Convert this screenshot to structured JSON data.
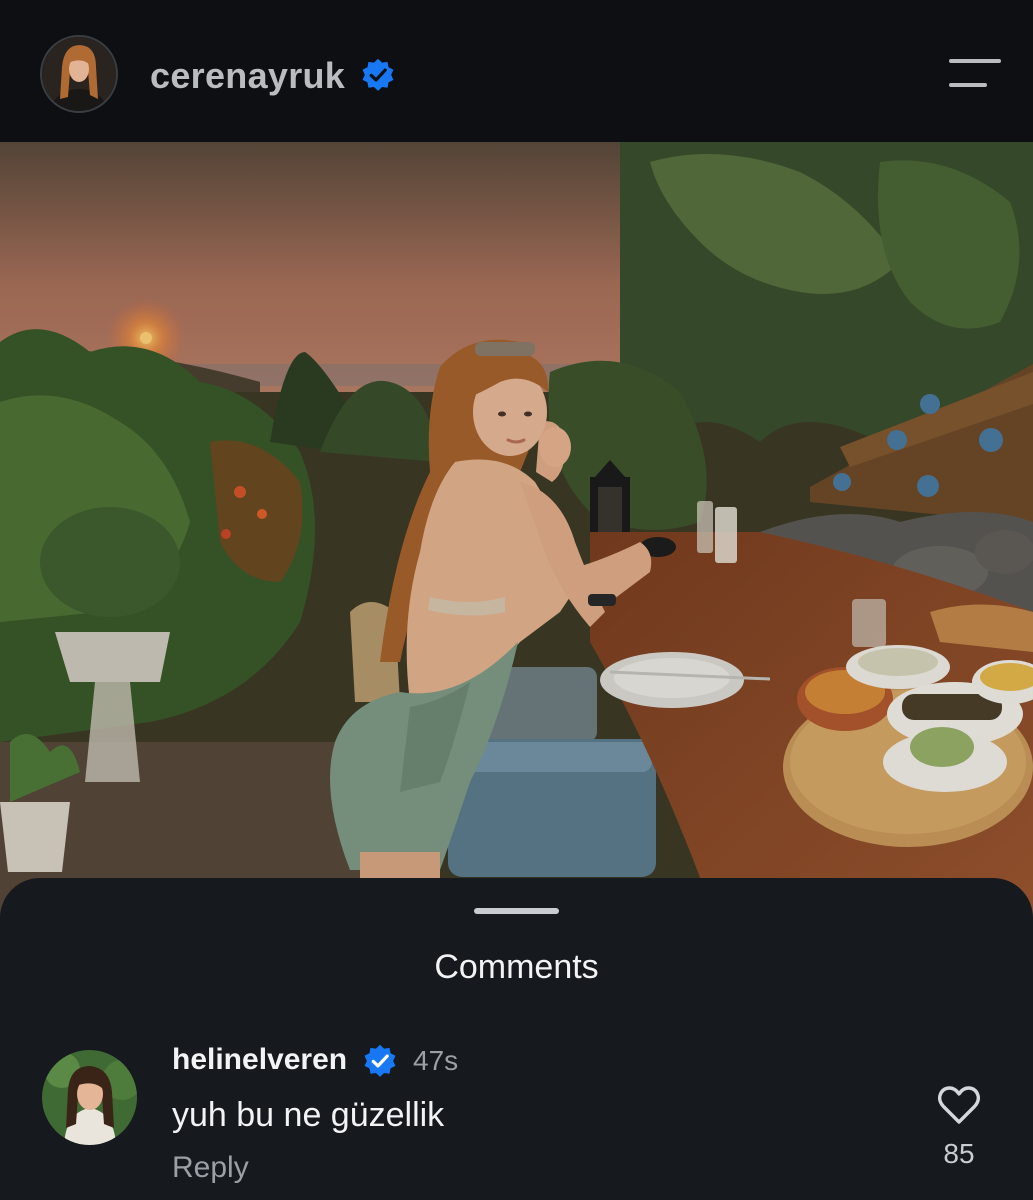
{
  "header": {
    "username": "cerenayruk",
    "verified_icon": "verified-badge-icon",
    "menu_icon": "hamburger-menu-icon"
  },
  "post": {
    "image": "photo-woman-at-sunset-dinner-table"
  },
  "comments_sheet": {
    "title": "Comments",
    "comments": [
      {
        "username": "helinelveren",
        "verified": true,
        "time": "47s",
        "text": "yuh bu ne güzellik",
        "reply_label": "Reply",
        "like_icon": "heart-icon",
        "likes": "85"
      }
    ]
  },
  "colors": {
    "background": "#0f1114",
    "sheet": "#16191d",
    "verified": "#1877f2",
    "muted_text": "#9aa0a6",
    "primary_text": "#f2f3f5"
  }
}
